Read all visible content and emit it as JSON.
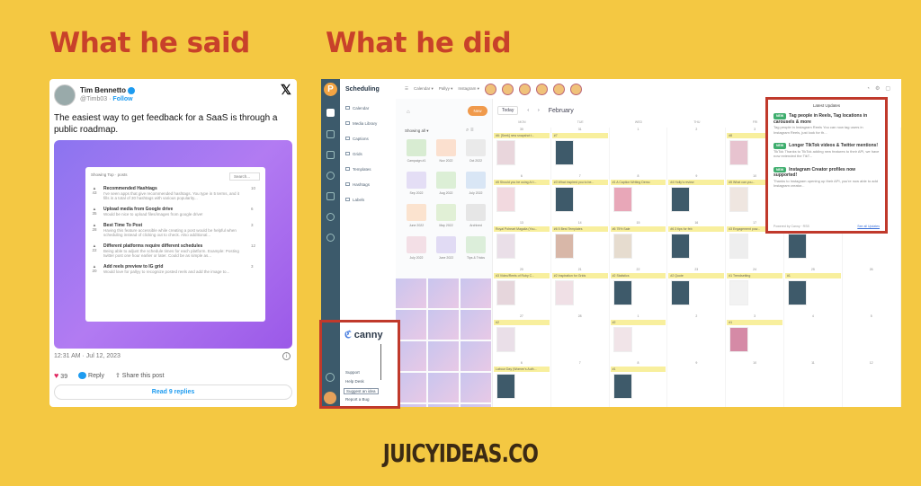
{
  "headings": {
    "left": "What he said",
    "right": "What he did"
  },
  "tweet": {
    "author": "Tim Bennetto",
    "handle": "@Timb03",
    "follow": "Follow",
    "text": "The easiest way to get feedback for a SaaS is through a public roadmap.",
    "roadmap": {
      "showing": "Showing  Top  ·  posts",
      "search_placeholder": "Search...",
      "items": [
        {
          "votes": "43",
          "title": "Recommended Hashtags",
          "desc": "I've seen apps that give recommended hashtags. You type in 5 terms, and it fills in a total of 30 hashtags with various popularity...",
          "comments": "10"
        },
        {
          "votes": "35",
          "title": "Upload media from Google drive",
          "desc": "Would be nice to upload files/images from google drive!",
          "comments": "6"
        },
        {
          "votes": "28",
          "title": "Best Time To Post",
          "desc": "Having this feature accessible while creating a post would be helpful when scheduling instead of clicking out to check. Also additional...",
          "comments": "3"
        },
        {
          "votes": "22",
          "title": "Different platforms require different schedules",
          "desc": "Being able to adjust the schedule times for each platform. Example: Posting twitter post one hour earlier or later. Could be as simple as...",
          "comments": "12"
        },
        {
          "votes": "20",
          "title": "Add reels preview to IG grid",
          "desc": "Would love for pallyy to recognize posted reels and add the image to...",
          "comments": "3"
        }
      ]
    },
    "timestamp": "12:31 AM · Jul 12, 2023",
    "likes": "39",
    "reply": "Reply",
    "share": "Share this post",
    "read_replies": "Read 9 replies"
  },
  "app": {
    "logo": "P",
    "title": "Scheduling",
    "nav": [
      "Calendar",
      "Media Library",
      "Captions",
      "Grids",
      "Templates",
      "Hashtags",
      "Labels"
    ],
    "topbar": [
      "Calendar ▾",
      "Pallyy ▾",
      "Instagram ▾"
    ],
    "new_button": "New",
    "today": "Today",
    "month": "February",
    "showing": "Showing all ▾",
    "folders": [
      {
        "name": "Campaign #1",
        "color": "#d8ecd2"
      },
      {
        "name": "Nov 2022",
        "color": "#fbe0cf"
      },
      {
        "name": "Oct 2022",
        "color": "#eaeaea"
      },
      {
        "name": "Sep 2022",
        "color": "#e4def5"
      },
      {
        "name": "Aug 2022",
        "color": "#dcefd6"
      },
      {
        "name": "July 2022",
        "color": "#d9e6f5"
      },
      {
        "name": "June 2022",
        "color": "#fbe3cf"
      },
      {
        "name": "May 2022",
        "color": "#e1f0d6"
      },
      {
        "name": "Archived",
        "color": "#e6e6e6"
      },
      {
        "name": "July 2022",
        "color": "#f3dfe6"
      },
      {
        "name": "June 2022",
        "color": "#e1dbf4"
      },
      {
        "name": "Tips & Tricks",
        "color": "#dceeda"
      }
    ],
    "weekdays": [
      "MON",
      "TUE",
      "WED",
      "THU",
      "FRI",
      "SAT",
      "SUN"
    ],
    "weeks": [
      [
        {
          "d": "30",
          "l": "#6: [Seek] new snapshot t...",
          "c": "#e9d6dc"
        },
        {
          "d": "31",
          "l": "#7",
          "c": "#3e5a6a"
        },
        {
          "d": "1"
        },
        {
          "d": "2"
        },
        {
          "d": "3",
          "l": "#8",
          "c": "#e7c3cf"
        },
        {
          "d": "4"
        },
        {
          "d": "5"
        }
      ],
      [
        {
          "d": "6",
          "l": "#5 Should you be using AI t...",
          "c": "#f2d9df"
        },
        {
          "d": "7",
          "l": "#3 What inspired you to be...",
          "c": "#3e5a6a"
        },
        {
          "d": "8",
          "l": "#1 A Caption Writing Demo",
          "c": "#e8a7b8"
        },
        {
          "d": "9",
          "l": "#4 Holly's review",
          "c": "#3e5a6a"
        },
        {
          "d": "10",
          "l": "#5 What can you...",
          "c": "#efe6e0"
        },
        {
          "d": "11"
        },
        {
          "d": "12"
        }
      ],
      [
        {
          "d": "13",
          "l": "Royal Poheart Magalia (You...",
          "c": "#eadfe8"
        },
        {
          "d": "14",
          "l": "#6 5 Best Templates",
          "c": "#d8b7a8"
        },
        {
          "d": "15",
          "l": "#6 75% Sale",
          "c": "#e6dccf"
        },
        {
          "d": "16",
          "l": "#6 3 tips for feb",
          "c": "#3e5a6a"
        },
        {
          "d": "17",
          "l": "#3 Engagement pow...",
          "c": "#eee"
        },
        {
          "d": "18",
          "l": "#3",
          "c": "#3e5a6a"
        },
        {
          "d": "19"
        }
      ],
      [
        {
          "d": "20",
          "l": "#3 Video/Reels of Ruby C...",
          "c": "#e6d6dc"
        },
        {
          "d": "21",
          "l": "#2 Inspiration for Grids",
          "c": "#f0e0e6"
        },
        {
          "d": "22",
          "l": "#2 Statistics",
          "c": "#3e5a6a"
        },
        {
          "d": "23",
          "l": "#2 Quote",
          "c": "#3e5a6a"
        },
        {
          "d": "24",
          "l": "#1 Trendsetting",
          "c": "#f2f2f2"
        },
        {
          "d": "25",
          "l": "#1",
          "c": "#3e5a6a"
        },
        {
          "d": "26"
        }
      ],
      [
        {
          "d": "27",
          "l": "#2",
          "c": "#eadfe8"
        },
        {
          "d": "28"
        },
        {
          "d": "1",
          "l": "#2",
          "c": "#f1e4e8"
        },
        {
          "d": "2"
        },
        {
          "d": "3",
          "l": "#1",
          "c": "#d58aa6"
        },
        {
          "d": "4"
        },
        {
          "d": "5"
        }
      ],
      [
        {
          "d": "6",
          "l": "Labour Day (Women's Auth...",
          "c": "#3e5a6a"
        },
        {
          "d": "7"
        },
        {
          "d": "8",
          "l": "#1",
          "c": "#3e5a6a"
        },
        {
          "d": "9"
        },
        {
          "d": "10"
        },
        {
          "d": "11"
        },
        {
          "d": "12"
        }
      ]
    ]
  },
  "canny": {
    "logo": "canny",
    "menu": [
      "Support",
      "Help Desk",
      "Suggest an idea",
      "Report a Bug"
    ]
  },
  "updates": {
    "title": "Latest Updates",
    "badge": "NEW",
    "items": [
      {
        "title": "Tag people in Reels, Tag locations in carousels & more",
        "desc": "Tag people in Instagram Reels You can now tag users in Instagram Reels, just look for th..."
      },
      {
        "title": "Longer TikTok videos & Twitter mentions!",
        "desc": "TikTok Thanks to TikTok adding new features to their API, we have now extended the TikT..."
      },
      {
        "title": "Instagram Creator profiles now supported!",
        "desc": "Thanks to Instagram opening up their API, you're now able to add Instagram creator..."
      }
    ],
    "powered": "Powered by Canny · RSS",
    "see_all": "See all Updates"
  },
  "footer": "JUICYIDEAS.CO",
  "colors": {
    "background": "#f4c842",
    "heading": "#c8412a",
    "highlight_box": "#c0392b",
    "sidebar": "#3c5a6b",
    "accent": "#f09a4c"
  }
}
